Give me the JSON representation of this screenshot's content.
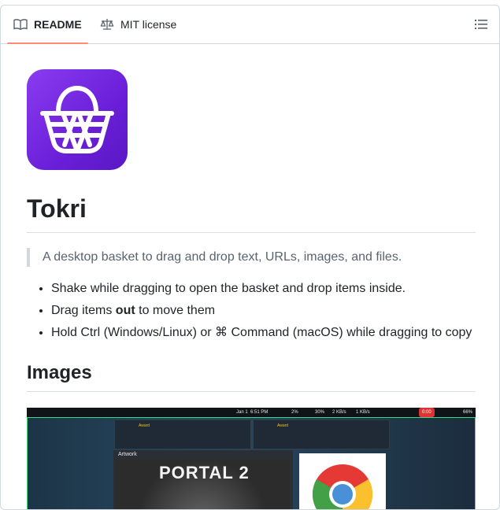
{
  "tabs": {
    "readme": "README",
    "license": "MIT license"
  },
  "readme": {
    "title": "Tokri",
    "tagline": "A desktop basket to drag and drop text, URLs, images, and files.",
    "features": [
      {
        "pre": "Shake while dragging to open the basket and drop items inside.",
        "bold": "",
        "post": ""
      },
      {
        "pre": "Drag items ",
        "bold": "out",
        "post": " to move them"
      },
      {
        "pre": "Hold Ctrl (Windows/Linux) or ⌘ Command (macOS) while dragging to copy",
        "bold": "",
        "post": ""
      }
    ],
    "images_heading": "Images"
  },
  "screenshot": {
    "date": "Jan 1",
    "time": "6:51 PM",
    "stats": [
      "2%",
      "30%",
      "2 KB/s",
      "1 KB/s"
    ],
    "rec": "0:00",
    "battery": "66%",
    "award": "Award",
    "artwork_label": "Artwork",
    "poster_text": "PORTAL 2"
  },
  "colors": {
    "accent_underline": "#fd8c73",
    "logo_purple": "#7b2ff0",
    "screenshot_border": "#3ddc84"
  }
}
